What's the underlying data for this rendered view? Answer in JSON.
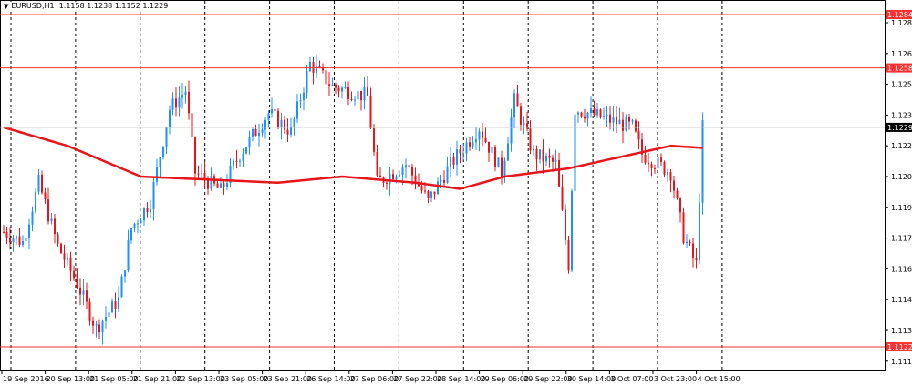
{
  "header": {
    "symbol": "EURUSD,H1",
    "open": "1.1158",
    "high": "1.1238",
    "low": "1.1152",
    "close": "1.1229"
  },
  "colors": {
    "bull": "#1e90ff",
    "bear": "#e8141a",
    "ma": "#e8141a",
    "level": "#ff3030",
    "grid": "#000000"
  },
  "chart_data": {
    "type": "candlestick",
    "title": "EURUSD,H1",
    "ylim": [
      1.1108,
      1.1292
    ],
    "y_ticks": [
      "1.1280",
      "1.1265",
      "1.1250",
      "1.1235",
      "1.1220",
      "1.1205",
      "1.1190",
      "1.1175",
      "1.1160",
      "1.1145",
      "1.1130",
      "1.1115"
    ],
    "x_ticks": [
      "19 Sep 2016",
      "20 Sep 13:00",
      "21 Sep 05:00",
      "21 Sep 21:00",
      "22 Sep 13:00",
      "23 Sep 05:00",
      "23 Sep 21:00",
      "26 Sep 14:00",
      "27 Sep 06:00",
      "27 Sep 22:00",
      "28 Sep 14:00",
      "29 Sep 06:00",
      "29 Sep 22:00",
      "30 Sep 14:00",
      "3 Oct 07:00",
      "3 Oct 23:00",
      "4 Oct 15:00"
    ],
    "levels": [
      {
        "price": 1.1284,
        "label": "1.1284"
      },
      {
        "price": 1.1258,
        "label": "1.1258"
      },
      {
        "price": 1.1122,
        "label": "1.1122"
      }
    ],
    "current_price": {
      "price": 1.1229,
      "label": "1.1229"
    },
    "price_path": [
      [
        0,
        1.1178
      ],
      [
        6,
        1.1173
      ],
      [
        11,
        1.1202
      ],
      [
        17,
        1.1171
      ],
      [
        23,
        1.1153
      ],
      [
        29,
        1.1131
      ],
      [
        36,
        1.1145
      ],
      [
        40,
        1.118
      ],
      [
        46,
        1.1193
      ],
      [
        52,
        1.1238
      ],
      [
        57,
        1.1247
      ],
      [
        60,
        1.1207
      ],
      [
        68,
        1.1198
      ],
      [
        74,
        1.1216
      ],
      [
        83,
        1.1236
      ],
      [
        90,
        1.1227
      ],
      [
        96,
        1.126
      ],
      [
        103,
        1.1249
      ],
      [
        114,
        1.1244
      ],
      [
        117,
        1.1202
      ],
      [
        126,
        1.1211
      ],
      [
        133,
        1.1193
      ],
      [
        140,
        1.1211
      ],
      [
        149,
        1.1229
      ],
      [
        156,
        1.1207
      ],
      [
        160,
        1.1242
      ],
      [
        166,
        1.1216
      ],
      [
        173,
        1.1211
      ],
      [
        177,
        1.1162
      ],
      [
        179,
        1.1238
      ],
      [
        189,
        1.1233
      ],
      [
        197,
        1.1229
      ],
      [
        200,
        1.1216
      ],
      [
        209,
        1.1207
      ],
      [
        213,
        1.1176
      ],
      [
        217,
        1.1162
      ],
      [
        219,
        1.1229
      ]
    ],
    "moving_average": [
      [
        0,
        1.1229
      ],
      [
        20,
        1.122
      ],
      [
        43,
        1.1205
      ],
      [
        86,
        1.1202
      ],
      [
        106,
        1.1205
      ],
      [
        129,
        1.1202
      ],
      [
        143,
        1.1199
      ],
      [
        157,
        1.1205
      ],
      [
        177,
        1.1209
      ],
      [
        209,
        1.122
      ],
      [
        219,
        1.1219
      ]
    ]
  }
}
